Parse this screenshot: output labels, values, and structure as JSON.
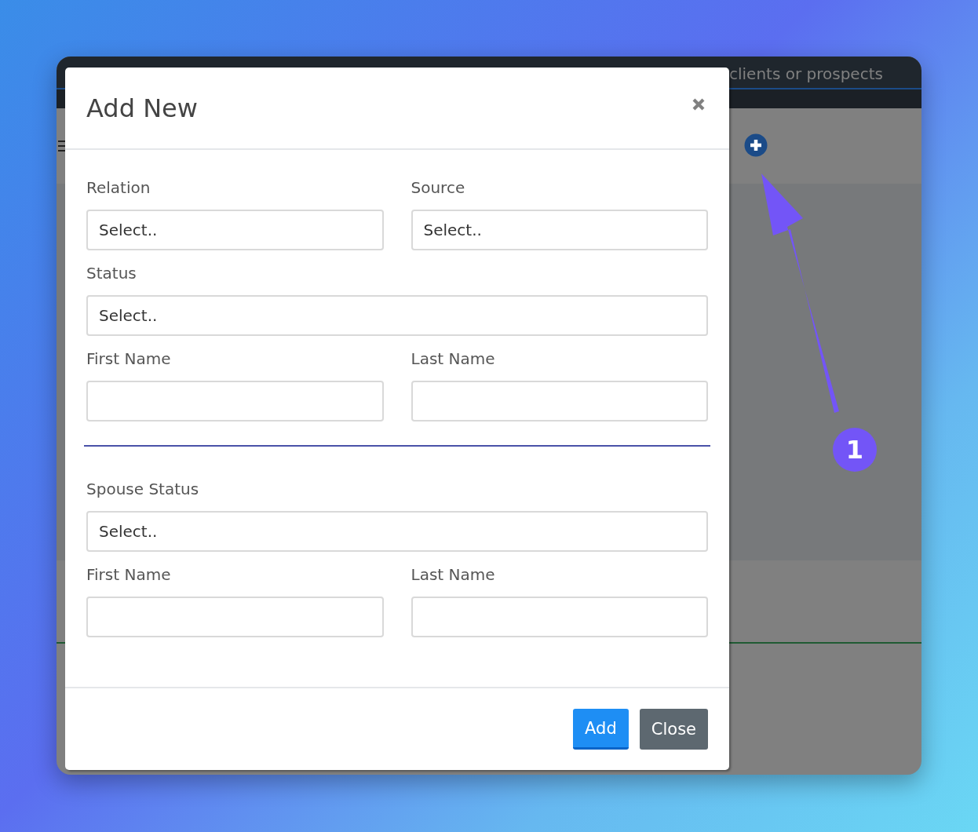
{
  "topbar": {
    "search_text": "clients or prospects"
  },
  "modal": {
    "title": "Add New",
    "sections": [
      {
        "rows": [
          [
            {
              "label": "Relation",
              "kind": "select",
              "value": "Select.."
            },
            {
              "label": "Source",
              "kind": "select",
              "value": "Select.."
            }
          ],
          [
            {
              "label": "Status",
              "kind": "select",
              "value": "Select.."
            }
          ],
          [
            {
              "label": "First Name",
              "kind": "text"
            },
            {
              "label": "Last Name",
              "kind": "text"
            }
          ]
        ]
      },
      {
        "rows": [
          [
            {
              "label": "Spouse Status",
              "kind": "select",
              "value": "Select.."
            }
          ],
          [
            {
              "label": "First Name",
              "kind": "text"
            },
            {
              "label": "Last Name",
              "kind": "text"
            }
          ]
        ]
      }
    ],
    "buttons": [
      {
        "label": "Add",
        "kind": "primary"
      },
      {
        "label": "Close",
        "kind": "secondary"
      }
    ]
  },
  "annotation": {
    "label": "1"
  }
}
